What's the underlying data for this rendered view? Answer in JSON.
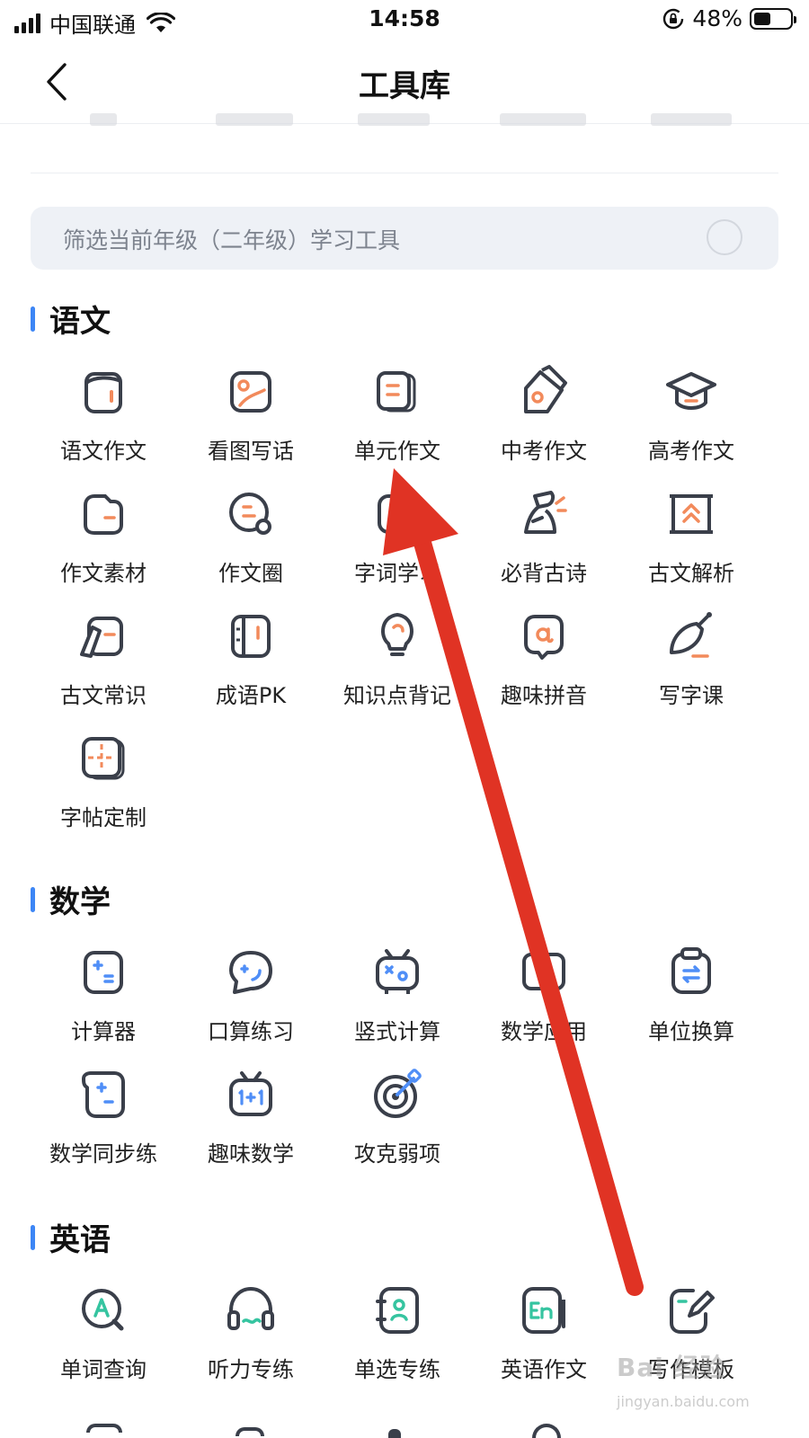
{
  "status_bar": {
    "carrier": "中国联通",
    "time": "14:58",
    "battery_percent": "48%",
    "battery_level": 0.48
  },
  "nav": {
    "title": "工具库",
    "back_icon": "chevron-left-icon"
  },
  "filter": {
    "label": "筛选当前年级（二年级）学习工具",
    "enabled": false
  },
  "sections": {
    "chinese": {
      "title": "语文",
      "items": [
        {
          "label": "语文作文",
          "icon": "notebook-icon"
        },
        {
          "label": "看图写话",
          "icon": "picture-icon"
        },
        {
          "label": "单元作文",
          "icon": "cards-icon"
        },
        {
          "label": "中考作文",
          "icon": "pen-ink-icon"
        },
        {
          "label": "高考作文",
          "icon": "graduation-cap-icon"
        },
        {
          "label": "作文素材",
          "icon": "folder-icon"
        },
        {
          "label": "作文圈",
          "icon": "chat-circle-icon"
        },
        {
          "label": "字词学习",
          "icon": "book-icon"
        },
        {
          "label": "必背古诗",
          "icon": "poet-icon"
        },
        {
          "label": "古文解析",
          "icon": "scroll-frame-icon"
        },
        {
          "label": "古文常识",
          "icon": "brush-scroll-icon"
        },
        {
          "label": "成语PK",
          "icon": "book-pk-icon"
        },
        {
          "label": "知识点背记",
          "icon": "lightbulb-icon"
        },
        {
          "label": "趣味拼音",
          "icon": "letter-a-icon"
        },
        {
          "label": "写字课",
          "icon": "brush-icon"
        },
        {
          "label": "字帖定制",
          "icon": "grid-card-icon"
        }
      ]
    },
    "math": {
      "title": "数学",
      "items": [
        {
          "label": "计算器",
          "icon": "calculator-icon"
        },
        {
          "label": "口算练习",
          "icon": "speech-bubble-icon"
        },
        {
          "label": "竖式计算",
          "icon": "robot-icon"
        },
        {
          "label": "数学应用",
          "icon": "math-app-icon"
        },
        {
          "label": "单位换算",
          "icon": "convert-icon"
        },
        {
          "label": "数学同步练",
          "icon": "math-book-icon"
        },
        {
          "label": "趣味数学",
          "icon": "tv-1plus1-icon"
        },
        {
          "label": "攻克弱项",
          "icon": "target-icon"
        }
      ]
    },
    "english": {
      "title": "英语",
      "items": [
        {
          "label": "单词查询",
          "icon": "search-a-icon"
        },
        {
          "label": "听力专练",
          "icon": "headphones-icon"
        },
        {
          "label": "单选专练",
          "icon": "contact-book-icon"
        },
        {
          "label": "英语作文",
          "icon": "en-book-icon"
        },
        {
          "label": "写作模板",
          "icon": "edit-note-icon"
        }
      ]
    }
  },
  "watermark": {
    "logo": "Bai 经验",
    "url": "jingyan.baidu.com"
  },
  "colors": {
    "accent_blue": "#3d86f5",
    "icon_dark": "#3a3f4a",
    "icon_orange": "#f28a5b",
    "icon_blue": "#4f8ef7",
    "icon_green": "#35c4a0",
    "arrow_red": "#e03324"
  }
}
